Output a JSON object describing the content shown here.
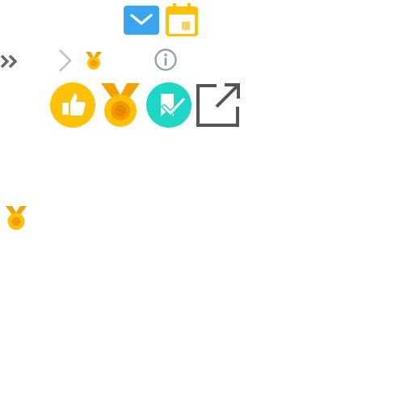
{
  "icons": {
    "mail": {
      "name": "mail-icon",
      "color": "#3aa4ef"
    },
    "calendar": {
      "name": "calendar-icon",
      "color": "#ffc107"
    },
    "double_chevron": {
      "name": "double-chevron-right-icon",
      "color": "#666666"
    },
    "chevron": {
      "name": "chevron-right-icon",
      "color": "#bdbdbd"
    },
    "medal_small": {
      "name": "medal-icon",
      "color": "#ffb300"
    },
    "info": {
      "name": "info-icon",
      "color": "#90a4ae"
    },
    "thumbs_up": {
      "name": "thumbs-up-icon",
      "color": "#ffc107"
    },
    "medal_large": {
      "name": "medal-icon",
      "color": "#ffb300"
    },
    "task_done": {
      "name": "task-done-icon",
      "color": "#1ed6c6"
    },
    "external_link": {
      "name": "external-link-icon",
      "color": "#555555"
    },
    "medal_standalone": {
      "name": "medal-icon",
      "color": "#ffb300"
    }
  },
  "colors": {
    "background": "#ffffff",
    "medal_ribbon": "#f2a100",
    "medal_inner": "#f59a00"
  }
}
